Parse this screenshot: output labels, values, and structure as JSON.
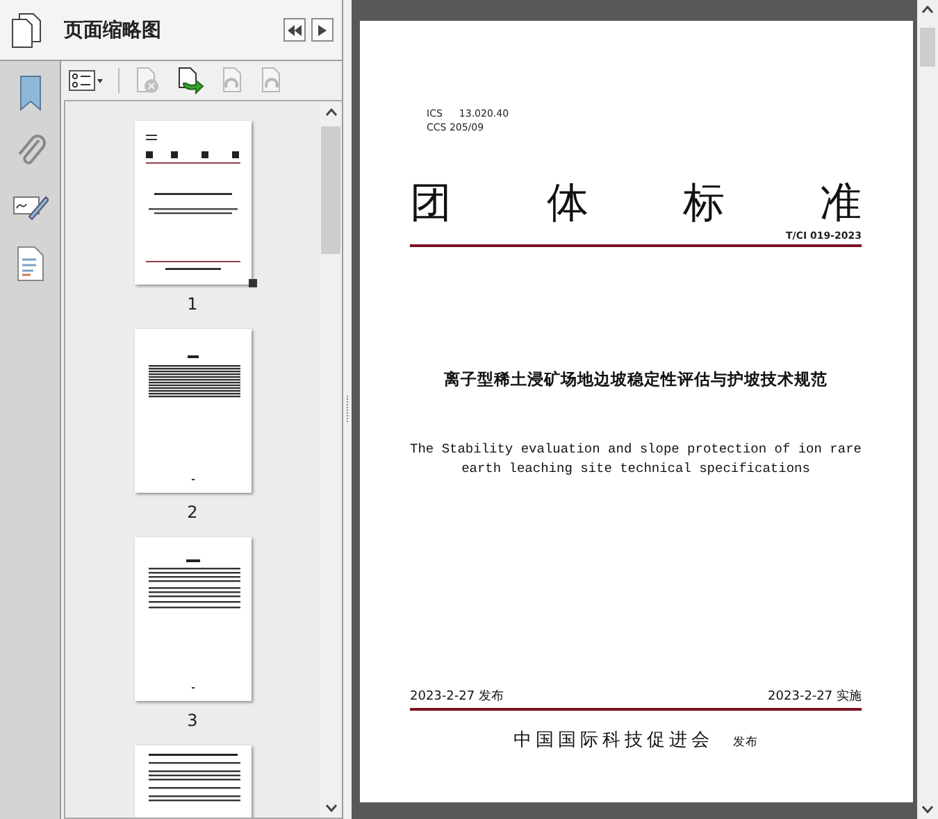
{
  "panel": {
    "title": "页面缩略图"
  },
  "toolbar": [
    {
      "kind": "options",
      "disabled": false
    },
    {
      "kind": "delete",
      "disabled": true
    },
    {
      "kind": "insert",
      "disabled": false
    },
    {
      "kind": "rotate_left",
      "disabled": true
    },
    {
      "kind": "rotate_right",
      "disabled": true
    }
  ],
  "thumbnails": [
    {
      "kind": "cover",
      "label": "1"
    },
    {
      "kind": "contents",
      "label": "2"
    },
    {
      "kind": "foreword",
      "label": "3"
    },
    {
      "kind": "body"
    }
  ],
  "document": {
    "ics": {
      "label": "ICS",
      "value": "13.020.40"
    },
    "ccs": "CCS 205/09",
    "heading": [
      "团",
      "体",
      "标",
      "准"
    ],
    "code": "T/CI 019-2023",
    "title_zh": "离子型稀土浸矿场地边坡稳定性评估与护坡技术规范",
    "title_en": [
      "The Stability evaluation and slope protection of ion rare",
      "earth leaching site technical specifications"
    ],
    "publish_date": "2023-2-27 发布",
    "effective_date": "2023-2-27 实施",
    "publisher": "中国国际科技促进会",
    "publisher_suffix": "发布"
  }
}
